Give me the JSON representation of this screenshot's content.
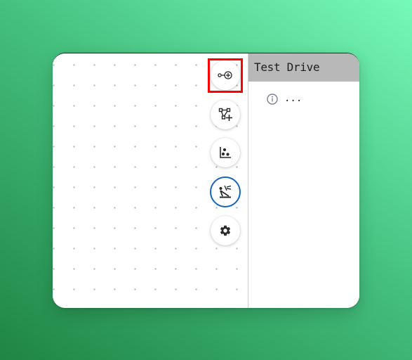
{
  "panel": {
    "title": "Test Drive",
    "info_text": "..."
  },
  "toolbar": {
    "buttons": [
      {
        "icon": "add-node-icon",
        "active": false,
        "highlighted": true
      },
      {
        "icon": "add-edge-icon",
        "active": false,
        "highlighted": false
      },
      {
        "icon": "scatter-chart-icon",
        "active": false,
        "highlighted": false
      },
      {
        "icon": "crane-icon",
        "active": true,
        "highlighted": false
      },
      {
        "icon": "gear-icon",
        "active": false,
        "highlighted": false
      }
    ]
  },
  "colors": {
    "active_ring": "#1565c0",
    "highlight": "#ff0000",
    "panel_header": "#b8b8b8"
  }
}
